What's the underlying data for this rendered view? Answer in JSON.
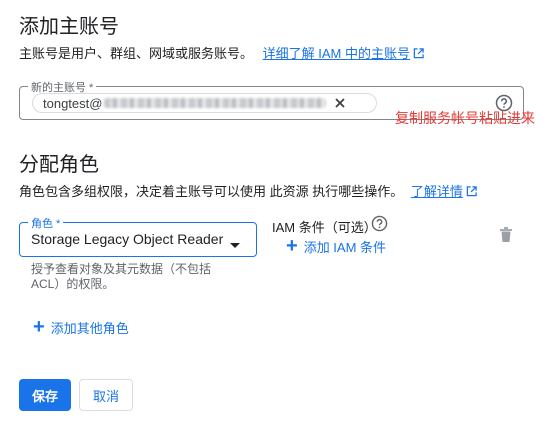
{
  "add_principals": {
    "title": "添加主账号",
    "description": "主账号是用户、群组、网域或服务账号。",
    "learn_more_link": "详细了解 IAM 中的主账号",
    "field_label": "新的主账号 *",
    "chip_text_prefix": "tongtest@",
    "annotation": "复制服务帐号粘贴进来"
  },
  "assign_roles": {
    "title": "分配角色",
    "description": "角色包含多组权限，决定着主账号可以使用 此资源 执行哪些操作。",
    "learn_more_link": "了解详情",
    "role_label": "角色 *",
    "role_value": "Storage Legacy Object Reader",
    "role_hint_line1": "授予查看对象及其元数据（不包括",
    "role_hint_line2": "ACL）的权限。",
    "iam_condition_label": "IAM 条件（可选）",
    "add_condition": "添加 IAM 条件",
    "add_another_role": "添加其他角色"
  },
  "buttons": {
    "save": "保存",
    "cancel": "取消"
  },
  "colors": {
    "primary": "#1a73e8",
    "annotation": "#e53935",
    "text": "#202124",
    "secondary_text": "#5f6368"
  },
  "icons": [
    "external-link-icon",
    "close-icon",
    "help-icon",
    "dropdown-arrow-icon",
    "plus-icon",
    "delete-icon"
  ]
}
